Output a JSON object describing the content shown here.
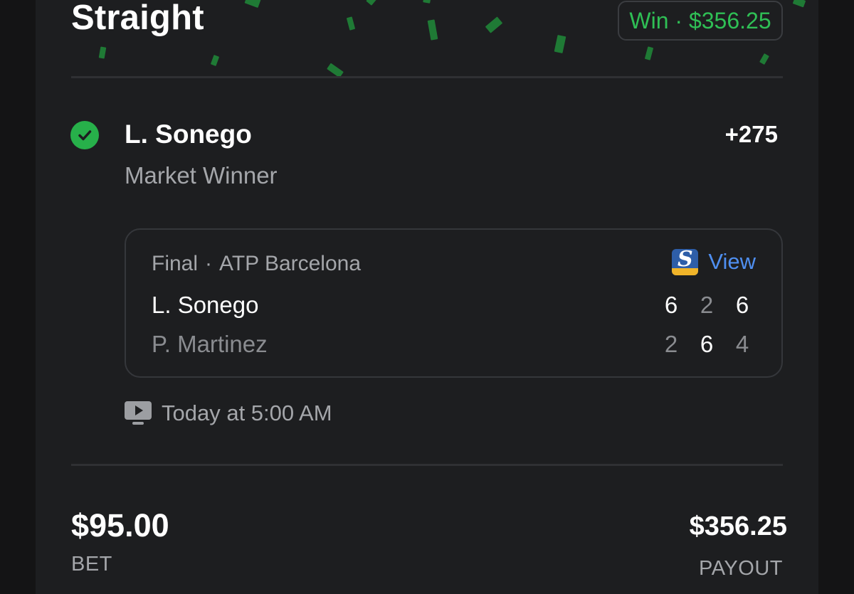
{
  "bet": {
    "type_title": "Straight",
    "result_badge": "Win · $356.25",
    "selection": {
      "name": "L. Sonego",
      "odds": "+275",
      "market": "Market Winner"
    },
    "event": {
      "status": "Final",
      "separator": "·",
      "competition": "ATP Barcelona",
      "view_label": "View",
      "view_icon_letter": "S",
      "players": [
        {
          "name": "L. Sonego",
          "sets": [
            "6",
            "2",
            "6"
          ],
          "set_won": [
            true,
            false,
            true
          ]
        },
        {
          "name": "P. Martinez",
          "sets": [
            "2",
            "6",
            "4"
          ],
          "set_won": [
            false,
            true,
            false
          ]
        }
      ]
    },
    "start_time": "Today at 5:00 AM",
    "stake": {
      "amount": "$95.00",
      "label": "BET"
    },
    "payout": {
      "amount": "$356.25",
      "label": "PAYOUT"
    }
  },
  "colors": {
    "background": "#141415",
    "card": "#1d1e20",
    "win_green": "#2fbf55",
    "check_green": "#27b04a",
    "link_blue": "#4f8ff0",
    "muted_text": "#a4a6aa"
  },
  "icons": [
    "check-circle-icon",
    "score-provider-logo-icon",
    "tv-play-icon"
  ]
}
